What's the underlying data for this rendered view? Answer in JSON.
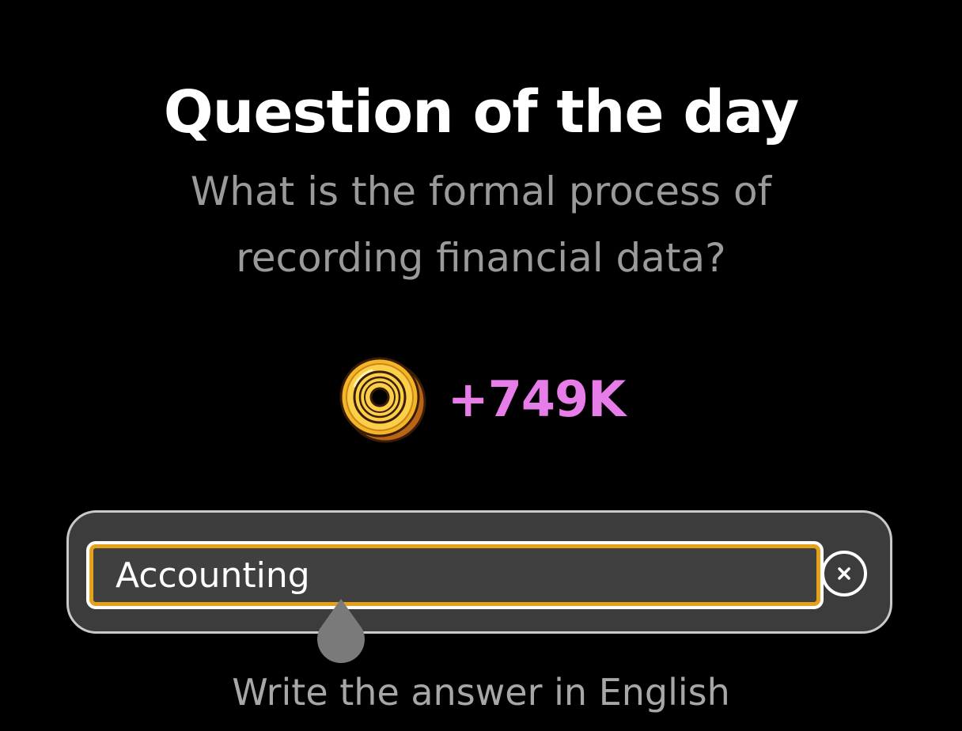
{
  "header": {
    "title": "Question of the day",
    "question": "What is the formal process of recording financial data?"
  },
  "reward": {
    "icon": "coin-icon",
    "amount": "+749K"
  },
  "answer": {
    "value": "Accounting",
    "clear_icon": "close-icon"
  },
  "hint": "Write the answer in English",
  "colors": {
    "background": "#000000",
    "question_text": "#9a9a9a",
    "reward_text": "#e77de8",
    "input_border": "#e5a11c",
    "panel_background": "#3c3c3c"
  }
}
